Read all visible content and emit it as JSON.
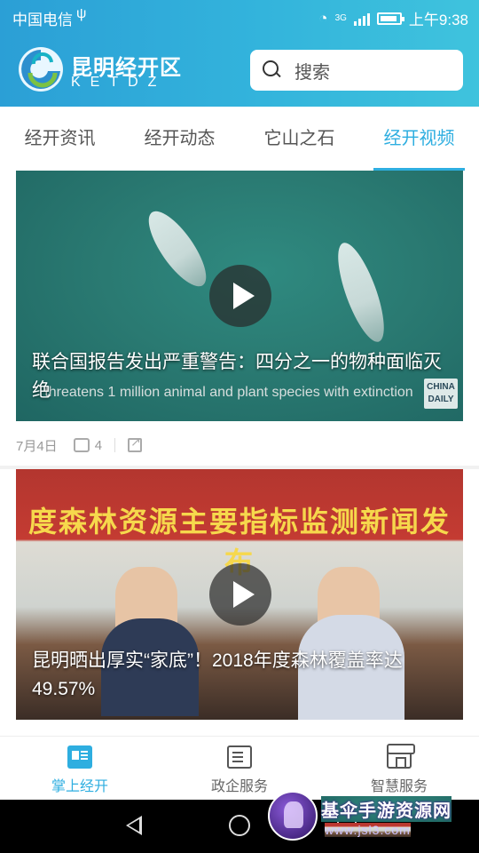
{
  "status_bar": {
    "carrier": "中国电信",
    "usb_icon": "usb-icon",
    "network": "3G",
    "time": "上午9:38"
  },
  "header": {
    "brand_name": "昆明经开区",
    "brand_sub": "KETDZ",
    "search_placeholder": "搜索",
    "accent": "#2eaee0"
  },
  "tabs": [
    {
      "label": "经开资讯",
      "active": false
    },
    {
      "label": "经开动态",
      "active": false
    },
    {
      "label": "它山之石",
      "active": false
    },
    {
      "label": "经开视频",
      "active": true
    }
  ],
  "feed": [
    {
      "caption": "联合国报告发出严重警告：四分之一的物种面临灭绝",
      "overlay_subtitle": "threatens 1 million animal and plant species with extinction",
      "overlay_logo": "CHINA DAILY",
      "date": "7月4日",
      "likes": "4"
    },
    {
      "caption": "昆明晒出厚实“家底”！2018年度森林覆盖率达49.57%",
      "overlay_banner": "度森林资源主要指标监测新闻发布"
    }
  ],
  "bottom_nav": [
    {
      "label": "掌上经开",
      "icon": "news-icon",
      "active": true
    },
    {
      "label": "政企服务",
      "icon": "gov-service-icon",
      "active": false
    },
    {
      "label": "智慧服务",
      "icon": "store-icon",
      "active": false
    }
  ],
  "watermark": {
    "title": "基伞手游资源网",
    "url": "www.jsl3.com"
  }
}
